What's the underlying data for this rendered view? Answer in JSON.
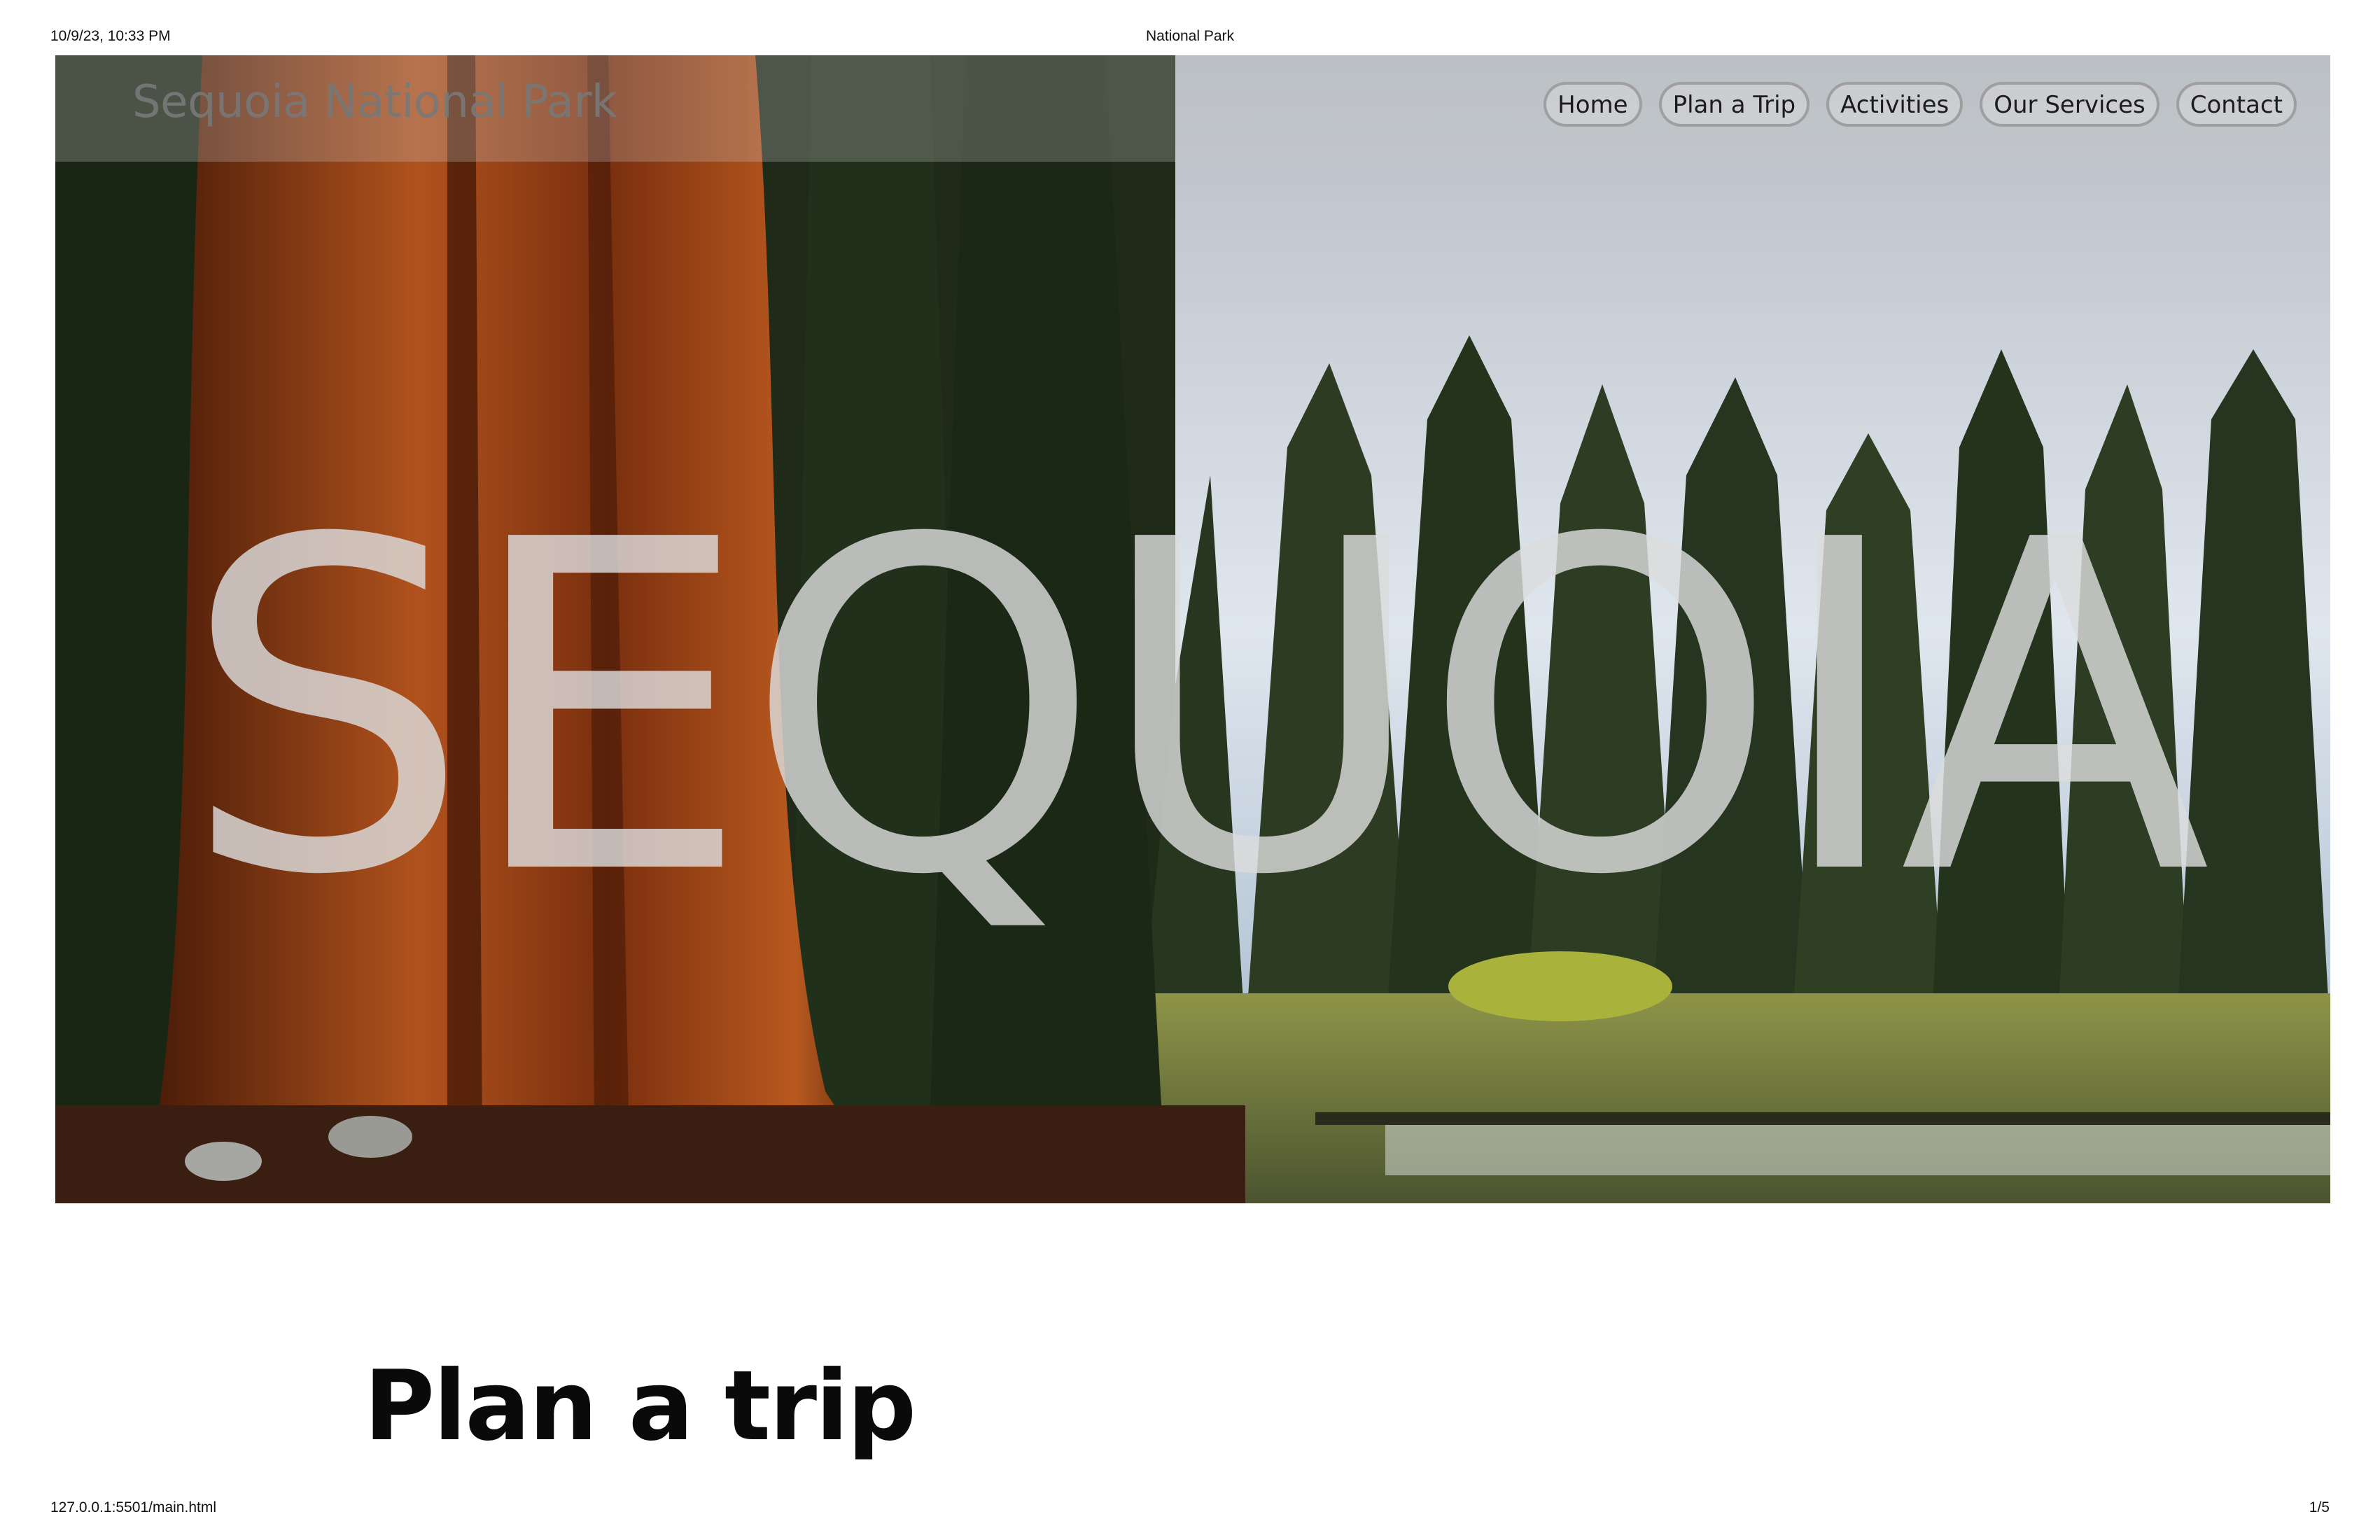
{
  "print_header": {
    "datetime": "10/9/23, 10:33 PM",
    "title": "National Park"
  },
  "print_footer": {
    "url": "127.0.0.1:5501/main.html",
    "page": "1/5"
  },
  "navbar": {
    "brand": "Sequoia National Park",
    "links": [
      "Home",
      "Plan a Trip",
      "Activities",
      "Our Services",
      "Contact"
    ]
  },
  "hero": {
    "big_word": "SEQUOIA"
  },
  "sections": {
    "plan_title": "Plan a trip"
  },
  "colors": {
    "sky": "#c9d3dd",
    "forest": "#2e3b22",
    "trunk": "#8a3a12",
    "meadow": "#7f8a4a"
  }
}
